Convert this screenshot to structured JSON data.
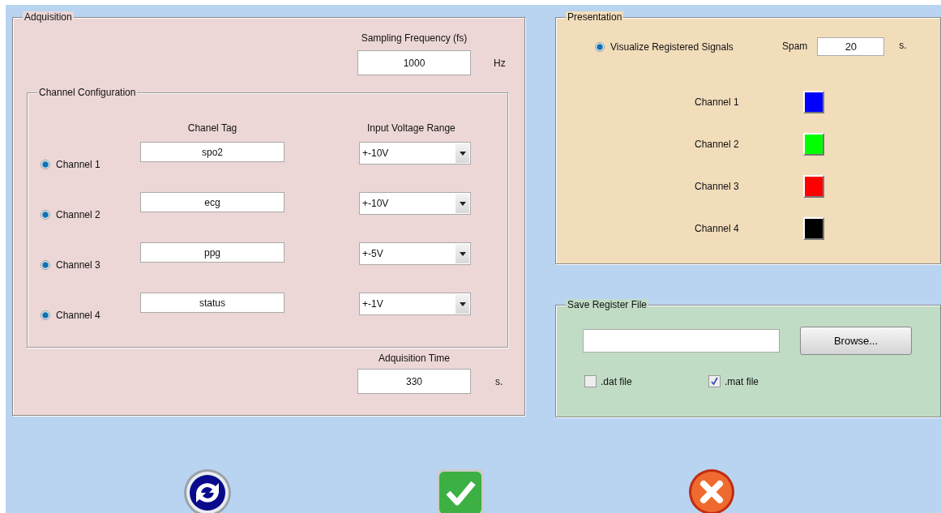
{
  "adquisition": {
    "title": "Adquisition",
    "sampling_frequency": {
      "label": "Sampling Frequency (fs)",
      "value": "1000",
      "unit": "Hz"
    },
    "channel_configuration": {
      "title": "Channel Configuration",
      "columns": [
        "Chanel Tag",
        "Input Voltage Range"
      ],
      "channels": [
        {
          "label": "Channel 1",
          "selected": true,
          "tag": "spo2",
          "range": "+-10V"
        },
        {
          "label": "Channel 2",
          "selected": true,
          "tag": "ecg",
          "range": "+-10V"
        },
        {
          "label": "Channel 3",
          "selected": true,
          "tag": "ppg",
          "range": "+-5V"
        },
        {
          "label": "Channel 4",
          "selected": true,
          "tag": "status",
          "range": "+-1V"
        }
      ]
    },
    "time": {
      "label": "Adquisition Time",
      "value": "330",
      "unit": "s."
    }
  },
  "presentation": {
    "title": "Presentation",
    "visualize": {
      "label": "Visualize Registered Signals",
      "selected": true
    },
    "span": {
      "label": "Spam",
      "value": "20",
      "unit": "s."
    },
    "channels": [
      {
        "label": "Channel 1",
        "color": "#0000ff"
      },
      {
        "label": "Channel 2",
        "color": "#00ff00"
      },
      {
        "label": "Channel 3",
        "color": "#ff0000"
      },
      {
        "label": "Channel 4",
        "color": "#000000"
      }
    ]
  },
  "save": {
    "title": "Save Register File",
    "browse": "Browse...",
    "formats": [
      {
        "label": ".dat file",
        "checked": false
      },
      {
        "label": ".mat file",
        "checked": true
      }
    ]
  },
  "actions": [
    {
      "kind": "refresh"
    },
    {
      "kind": "accept"
    },
    {
      "kind": "cancel"
    }
  ]
}
